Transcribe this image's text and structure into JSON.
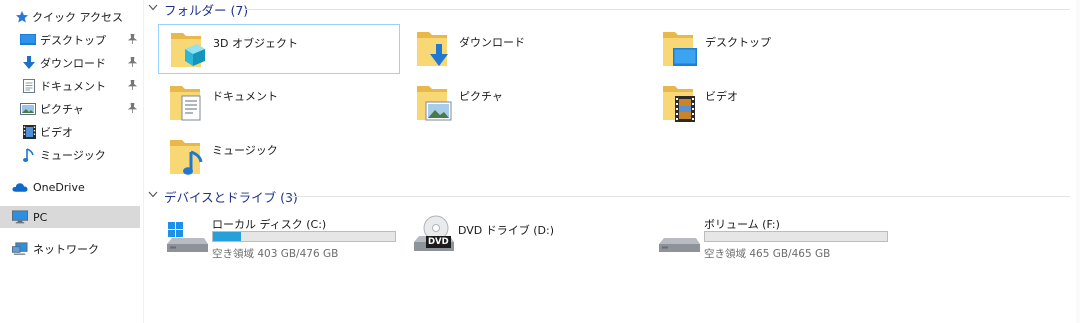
{
  "nav": {
    "items": [
      {
        "label": "クイック アクセス",
        "icon": "star-icon"
      },
      {
        "label": "デスクトップ",
        "icon": "desktop-icon",
        "pinned": true
      },
      {
        "label": "ダウンロード",
        "icon": "download-icon",
        "pinned": true
      },
      {
        "label": "ドキュメント",
        "icon": "document-icon",
        "pinned": true
      },
      {
        "label": "ピクチャ",
        "icon": "pictures-icon",
        "pinned": true
      },
      {
        "label": "ビデオ",
        "icon": "videos-icon"
      },
      {
        "label": "ミュージック",
        "icon": "music-icon"
      },
      {
        "label": "OneDrive",
        "icon": "onedrive-cloud-icon"
      },
      {
        "label": "PC",
        "icon": "pc-monitor-icon",
        "selected": true
      },
      {
        "label": "ネットワーク",
        "icon": "network-icon"
      }
    ],
    "pin_glyph": "📌"
  },
  "folders": {
    "header": "フォルダー (7)",
    "items": [
      {
        "label": "3D オブジェクト",
        "icon": "3d-objects-folder-icon",
        "selected": true
      },
      {
        "label": "ダウンロード",
        "icon": "downloads-folder-icon"
      },
      {
        "label": "デスクトップ",
        "icon": "desktop-folder-icon"
      },
      {
        "label": "ドキュメント",
        "icon": "documents-folder-icon"
      },
      {
        "label": "ピクチャ",
        "icon": "pictures-folder-icon"
      },
      {
        "label": "ビデオ",
        "icon": "videos-folder-icon"
      },
      {
        "label": "ミュージック",
        "icon": "music-folder-icon"
      }
    ]
  },
  "drives": {
    "header": "デバイスとドライブ (3)",
    "items": [
      {
        "label": "ローカル ディスク (C:)",
        "icon": "windows-drive-icon",
        "used_fraction": 0.153,
        "free_text": "空き領域 403 GB/476 GB"
      },
      {
        "label": "DVD ドライブ (D:)",
        "icon": "dvd-drive-icon",
        "badge": "DVD"
      },
      {
        "label": "ボリューム (F:)",
        "icon": "hard-drive-icon",
        "used_fraction": 0.0,
        "free_text": "空き領域 465 GB/465 GB"
      }
    ]
  },
  "colors": {
    "accent": "#26a0da",
    "header_text": "#1e3287",
    "selection": "#d9d9d9"
  }
}
